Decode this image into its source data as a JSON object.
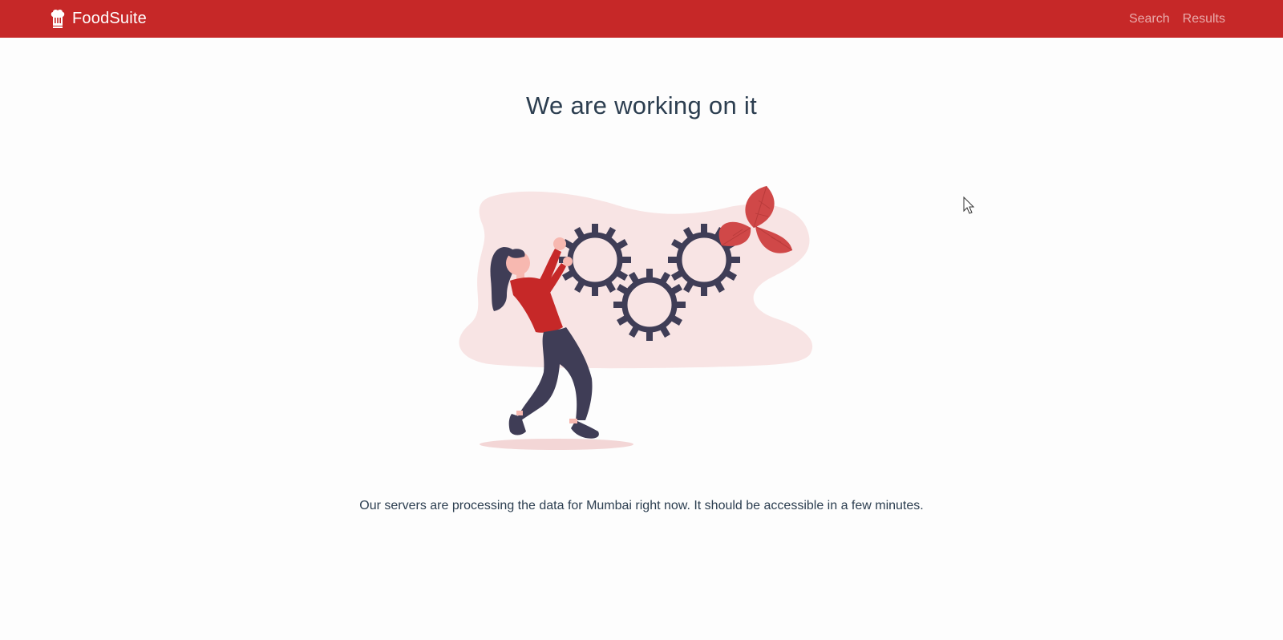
{
  "app": {
    "name": "FoodSuite",
    "brand_icon": "chef-hat-icon"
  },
  "nav": {
    "links": [
      {
        "label": "Search"
      },
      {
        "label": "Results"
      }
    ]
  },
  "main": {
    "title": "We are working on it",
    "illustration_icon": "woman-pushing-gears-illustration",
    "message": "Our servers are processing the data for Mumbai right now. It should be accessible in a few minutes."
  },
  "colors": {
    "navbar": "#c62828",
    "accent": "#d32f2f",
    "text": "#2c3e50",
    "gear": "#3f3d56",
    "blob": "#f8e4e4"
  }
}
